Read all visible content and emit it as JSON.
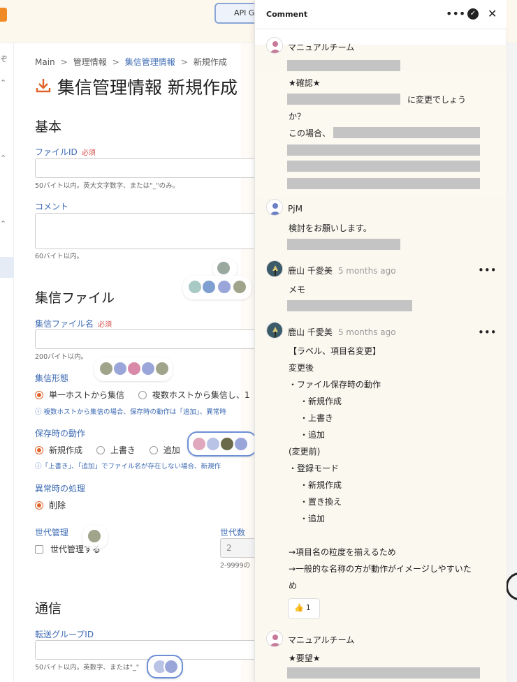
{
  "topbar": {
    "api_button_label": "API G"
  },
  "breadcrumb": {
    "items": [
      "Main",
      "管理情報",
      "集信管理情報",
      "新規作成"
    ]
  },
  "page_title": "集信管理情報 新規作成",
  "form": {
    "section_basic": "基本",
    "file_id_label": "ファイルID",
    "required": "必須",
    "file_id_hint": "50バイト以内。英大文字数字、または\"_\"のみ。",
    "comment_label": "コメント",
    "comment_hint": "60バイト以内。",
    "section_file": "集信ファイル",
    "file_name_label": "集信ファイル名",
    "file_name_hint": "200バイト以内。",
    "mode_label": "集信形態",
    "mode_options": [
      "単一ホストから集信",
      "複数ホストから集信し、1"
    ],
    "mode_hint": "ⓘ 複数ホストから集信の場合、保存時の動作は「追加」、異常時",
    "save_label": "保存時の動作",
    "save_options": [
      "新規作成",
      "上書き",
      "追加"
    ],
    "save_hint": "ⓘ「上書き」、「追加」でファイル名が存在しない場合、新規作",
    "error_label": "異常時の処理",
    "error_option": "削除",
    "gen_label": "世代管理",
    "gen_checkbox": "世代管理する",
    "gen_count_label": "世代数",
    "gen_count_value": "2",
    "gen_count_hint": "2-9999の",
    "section_comm": "通信",
    "group_label": "転送グループID",
    "group_hint": "50バイト以内。英数字、または\"_\""
  },
  "panel": {
    "title": "Comment",
    "comments": [
      {
        "author": "マニュアルチーム",
        "time": "",
        "lines": [
          "★確認★",
          "に変更でしょう",
          "か？",
          "この場合、"
        ]
      },
      {
        "author": "PjM",
        "time": "",
        "lines": [
          "検討をお願いします。"
        ]
      },
      {
        "author": "鹿山 千愛美",
        "time": "5 months ago",
        "lines": [
          "メモ"
        ]
      },
      {
        "author": "鹿山 千愛美",
        "time": "5 months ago",
        "lines": [
          "【ラベル、項目名変更】",
          "変更後",
          "・ファイル保存時の動作",
          "・新規作成",
          "・上書き",
          "・追加",
          "(変更前)",
          "・登録モード",
          "・新規作成",
          "・置き換え",
          "・追加",
          "→項目名の粒度を揃えるため",
          "→一般的な名称の方が動作がイメージしやすいた",
          "め"
        ],
        "reaction_count": "1"
      },
      {
        "author": "マニュアルチーム",
        "time": "",
        "lines": [
          "★要望★"
        ]
      }
    ]
  }
}
